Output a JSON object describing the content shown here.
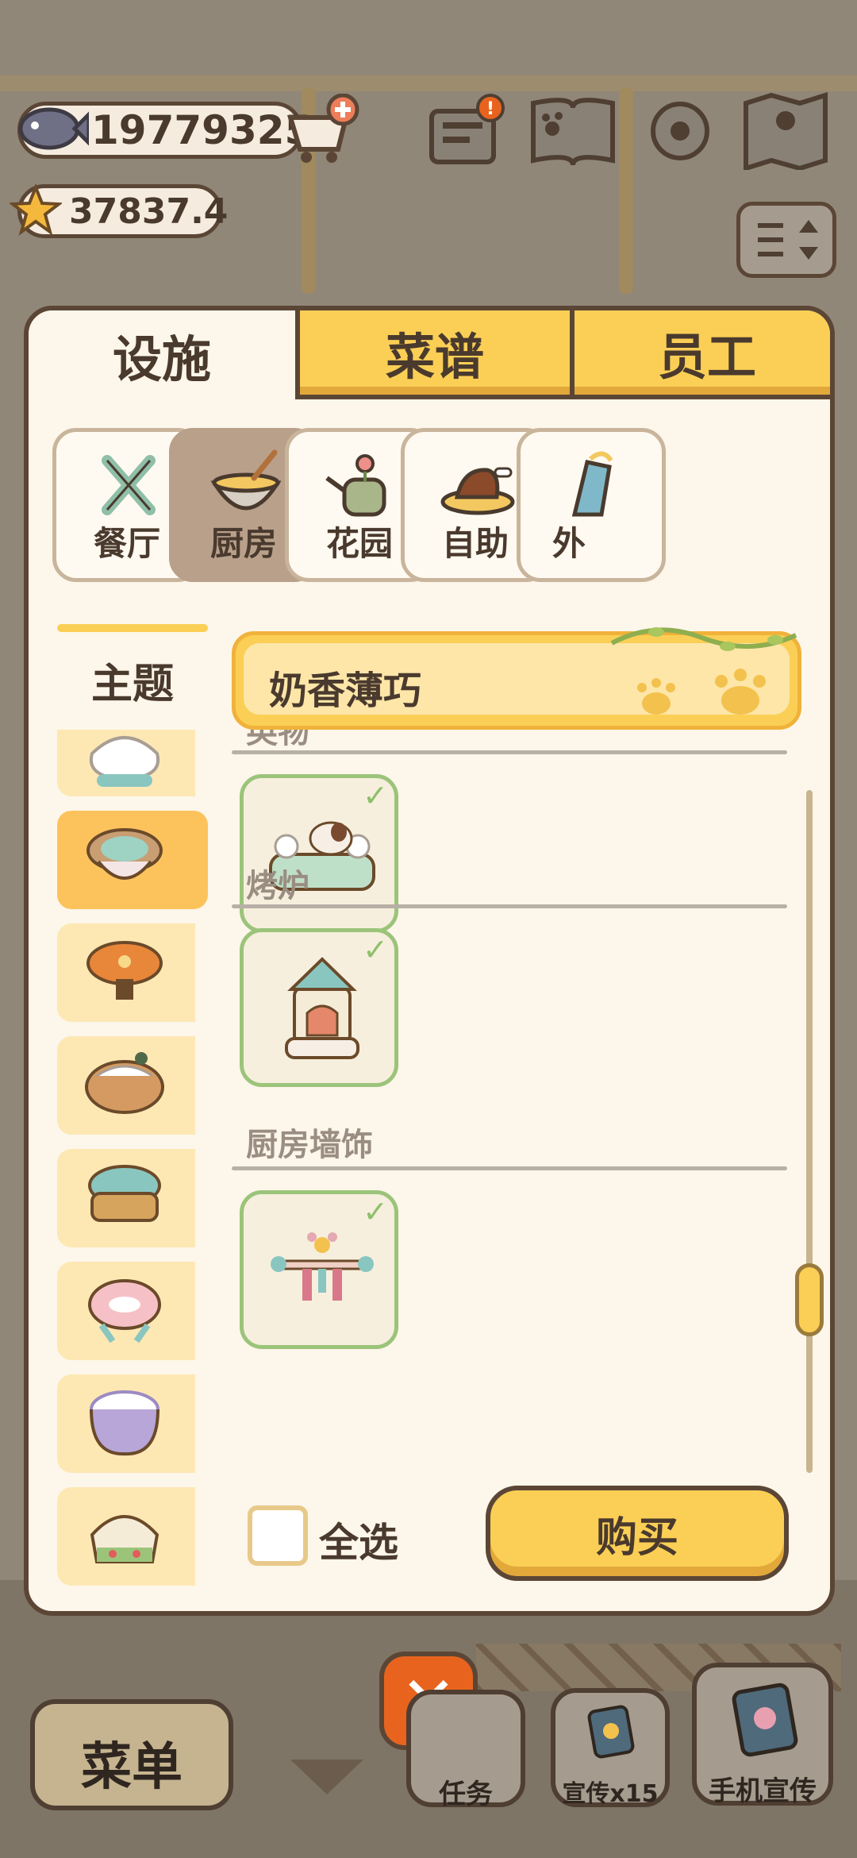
{
  "currency": {
    "fish": "19779325",
    "stars": "37837.4"
  },
  "tabs": [
    {
      "label": "设施",
      "active": true
    },
    {
      "label": "菜谱",
      "active": false
    },
    {
      "label": "员工",
      "active": false
    }
  ],
  "categories": [
    {
      "label": "餐厅",
      "icon": "tools-icon",
      "selected": false
    },
    {
      "label": "厨房",
      "icon": "mixing-bowl-icon",
      "selected": true
    },
    {
      "label": "花园",
      "icon": "watering-can-icon",
      "selected": false
    },
    {
      "label": "自助",
      "icon": "buffet-plate-icon",
      "selected": false
    },
    {
      "label": "外",
      "icon": "takeout-icon",
      "selected": false
    }
  ],
  "theme": {
    "label": "主题",
    "current": "奶香薄巧"
  },
  "sections": [
    {
      "title": "英物",
      "owned": true
    },
    {
      "title": "烤炉",
      "owned": true
    },
    {
      "title": "厨房墙饰",
      "owned": true
    }
  ],
  "footer": {
    "select_all": "全选",
    "buy": "购买"
  },
  "close": "✕",
  "nav": {
    "menu": "菜单",
    "task": "任务",
    "promo": "宣传x15",
    "phone": "手机宣传"
  },
  "colors": {
    "accent_yellow": "#fbcf55",
    "outline_brown": "#5b4636",
    "owned_green": "#9bc47a",
    "close_orange": "#e8641e"
  }
}
